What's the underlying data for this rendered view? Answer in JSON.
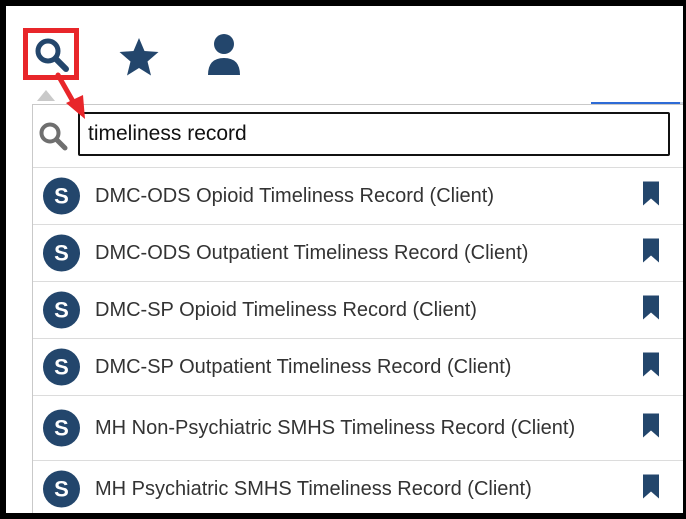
{
  "search": {
    "query": "timeliness record"
  },
  "icons": {
    "search": "search-icon",
    "star": "star-icon",
    "user": "user-icon",
    "badge": "service-badge",
    "bookmark": "bookmark-icon"
  },
  "colors": {
    "highlight": "#e8262a",
    "icon": "#23466c",
    "badge_bg": "#23466c",
    "text": "#333333"
  },
  "results": [
    {
      "badge": "S",
      "label": "DMC-ODS Opioid Timeliness Record (Client)"
    },
    {
      "badge": "S",
      "label": "DMC-ODS Outpatient Timeliness Record (Client)"
    },
    {
      "badge": "S",
      "label": "DMC-SP Opioid Timeliness Record (Client)"
    },
    {
      "badge": "S",
      "label": "DMC-SP Outpatient Timeliness Record (Client)"
    },
    {
      "badge": "S",
      "label": "MH Non-Psychiatric SMHS Timeliness Record (Client)"
    },
    {
      "badge": "S",
      "label": "MH Psychiatric SMHS Timeliness Record (Client)"
    }
  ]
}
